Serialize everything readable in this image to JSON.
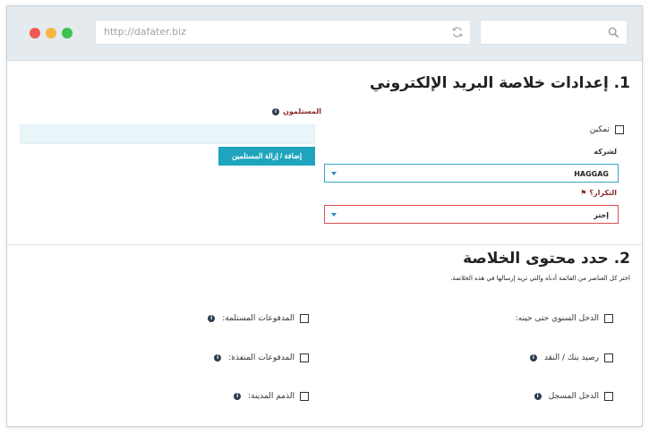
{
  "browser": {
    "url": "http://dafater.biz",
    "search_placeholder": ""
  },
  "section1": {
    "title": "1. إعدادات خلاصة البريد الإلكتروني",
    "recipients_label": "المستلمون",
    "add_remove_button": "إضافة / إزالة المستلمين",
    "enable_label": "تمكين",
    "company_label": "لشركة",
    "company_value": "HAGGAG",
    "repeat_label": "التكرار؟",
    "repeat_value": "إختر"
  },
  "section2": {
    "title": "2. حدد محتوى الخلاصة",
    "description": "اختر كل العناصر من القائمة أدناه والتي تريد إرسالها في هذه الخلاصة.",
    "items": [
      {
        "label": "الدخل السنوي حتى حينه:",
        "info": false
      },
      {
        "label": "المدفوعات المستلمة:",
        "info": true
      },
      {
        "label": "رصيد بنك / النقد",
        "info": true
      },
      {
        "label": "المدفوعات المنفذة:",
        "info": true
      },
      {
        "label": "الدخل المسجل",
        "info": true
      },
      {
        "label": "الذمم المدينة:",
        "info": true
      }
    ]
  },
  "colors": {
    "accent": "#1ea5bd",
    "error_border": "#d94f4f",
    "focus_border": "#33a8c4",
    "label_dark_red": "#8a2a2a"
  }
}
